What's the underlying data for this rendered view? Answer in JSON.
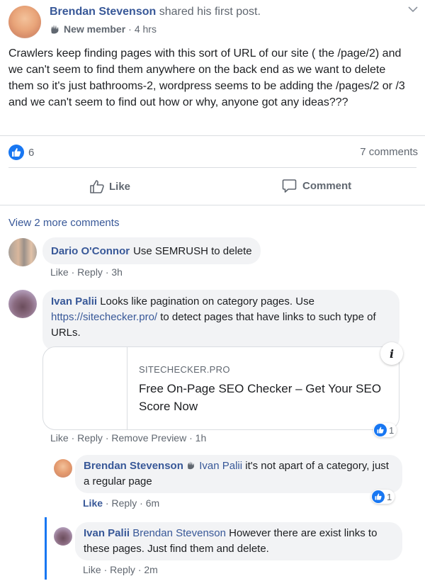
{
  "post": {
    "author": "Brendan Stevenson",
    "action": "shared his first post.",
    "badge": "New member",
    "time": "4 hrs",
    "text": "Crawlers keep finding pages with this sort of URL of our site ( the /page/2) and we can't seem to find them anywhere on the back end as we want to delete them so it's just bathrooms-2, wordpress seems to be adding the /pages/2 or /3 and we can't seem to find out how or why, anyone got any ideas???",
    "likes": "6",
    "comments_count": "7 comments",
    "like_label": "Like",
    "comment_label": "Comment",
    "view_more": "View 2 more comments"
  },
  "comments": [
    {
      "author": "Dario O'Connor",
      "text": "Use SEMRUSH to delete",
      "like": "Like",
      "reply": "Reply",
      "time": "3h"
    },
    {
      "author": "Ivan Palii",
      "text_before": "Looks like pagination on category pages. Use",
      "url": "https://sitechecker.pro/",
      "text_after": "to detect pages that have links to such type of URLs.",
      "preview_domain": "SITECHECKER.PRO",
      "preview_title": "Free On-Page SEO Checker – Get Your SEO Score Now",
      "info": "i",
      "reactions": "1",
      "like": "Like",
      "reply": "Reply",
      "remove_preview": "Remove Preview",
      "time": "1h"
    }
  ],
  "replies": [
    {
      "author": "Brendan Stevenson",
      "mention": "Ivan Palii",
      "text": "it's not apart of a category, just a regular page",
      "reactions": "1",
      "like": "Like",
      "reply": "Reply",
      "time": "6m"
    },
    {
      "author": "Ivan Palii",
      "mention": "Brendan Stevenson",
      "text": "However there are exist links to these pages. Just find them and delete.",
      "like": "Like",
      "reply": "Reply",
      "time": "2m"
    }
  ],
  "colors": {
    "link": "#385898",
    "accent": "#1877f2",
    "bubble": "#f2f3f5",
    "muted": "#606770"
  },
  "icons": [
    "chevron-down-icon",
    "new-member-icon",
    "like-reaction-icon",
    "thumbs-up-icon",
    "comment-icon",
    "info-icon"
  ]
}
